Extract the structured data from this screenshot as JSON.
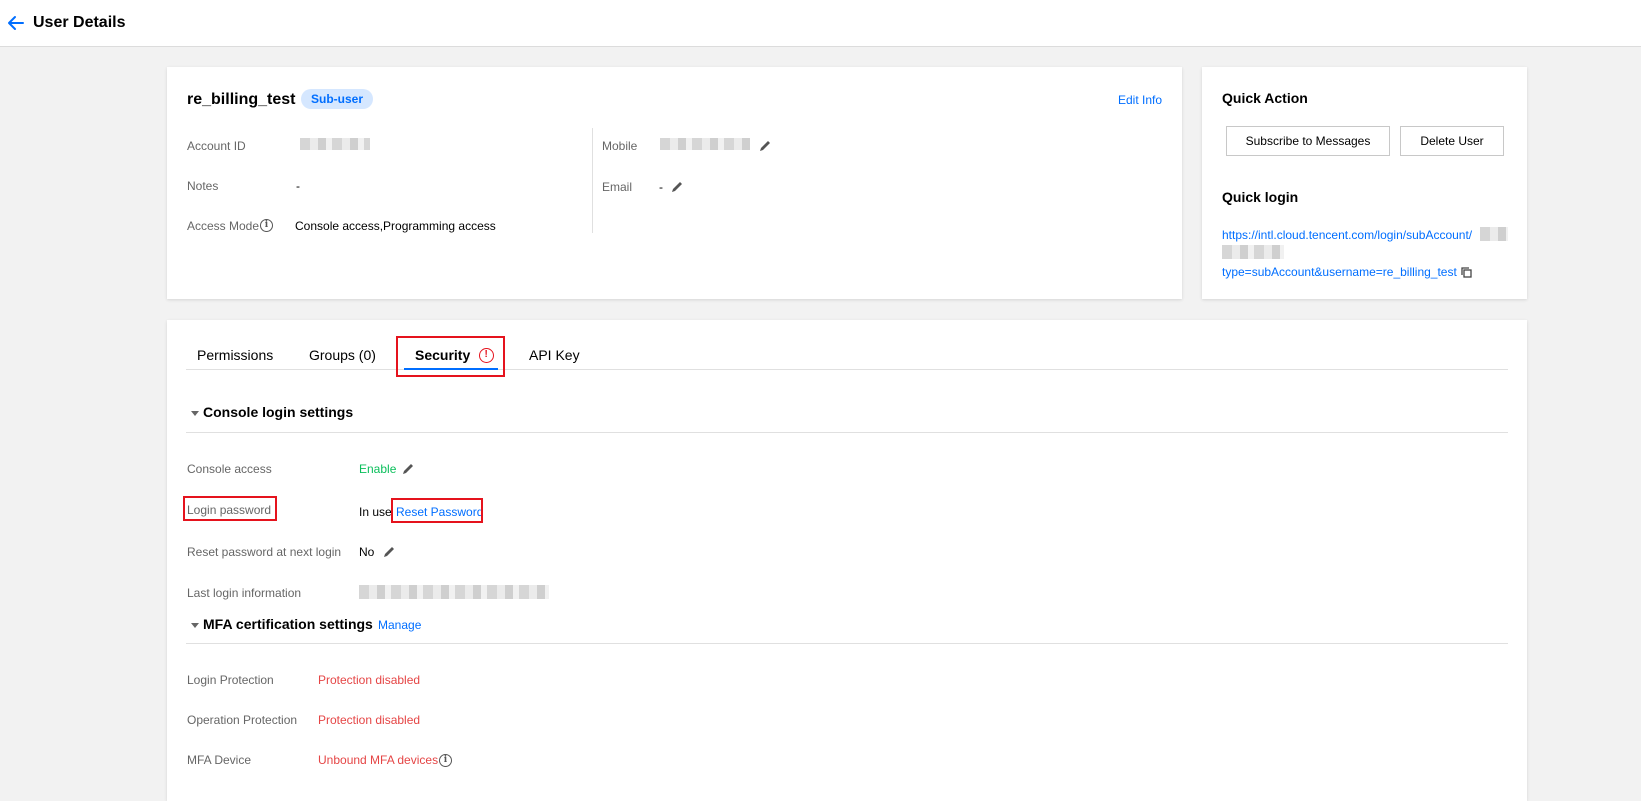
{
  "header": {
    "title": "User Details"
  },
  "user": {
    "name": "re_billing_test",
    "badge": "Sub-user",
    "edit_info": "Edit Info",
    "fields": {
      "account_id_label": "Account ID",
      "notes_label": "Notes",
      "notes_value": "-",
      "access_mode_label": "Access Mode",
      "access_mode_value": "Console access,Programming access",
      "mobile_label": "Mobile",
      "email_label": "Email",
      "email_value": "-"
    }
  },
  "quick_action": {
    "title": "Quick Action",
    "subscribe_button": "Subscribe to Messages",
    "delete_button": "Delete User",
    "quick_login_title": "Quick login",
    "login_url_line1": "https://intl.cloud.tencent.com/login/subAccount/",
    "login_url_line2": "type=subAccount&username=re_billing_test"
  },
  "tabs": [
    {
      "label": "Permissions"
    },
    {
      "label": "Groups (0)"
    },
    {
      "label": "Security"
    },
    {
      "label": "API Key"
    }
  ],
  "console_login": {
    "title": "Console login settings",
    "console_access_label": "Console access",
    "console_access_value": "Enable",
    "login_password_label": "Login password",
    "login_password_value": "In use",
    "reset_password_link": "Reset Password",
    "reset_next_login_label": "Reset password at next login",
    "reset_next_login_value": "No",
    "last_login_label": "Last login information"
  },
  "mfa": {
    "title": "MFA certification settings",
    "manage_link": "Manage",
    "login_protection_label": "Login Protection",
    "login_protection_value": "Protection disabled",
    "operation_protection_label": "Operation Protection",
    "operation_protection_value": "Protection disabled",
    "mfa_device_label": "MFA Device",
    "mfa_device_value": "Unbound MFA devices"
  },
  "colors": {
    "accent": "#006eff",
    "success": "#0abf5b",
    "danger": "#e54545",
    "highlight_box": "#e5131d"
  }
}
